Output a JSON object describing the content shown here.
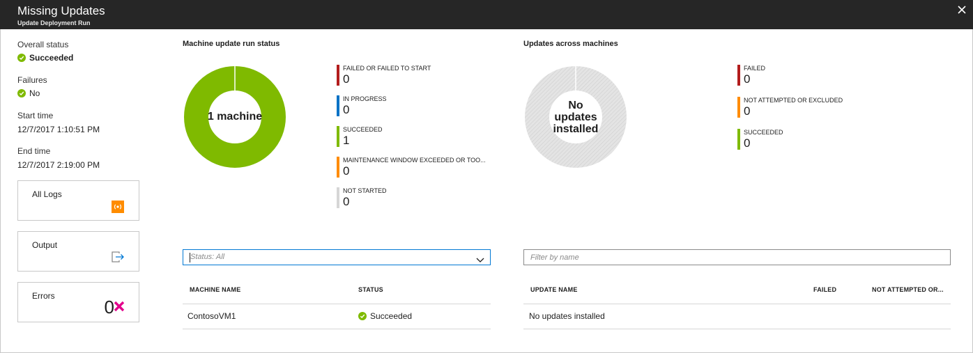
{
  "header": {
    "title": "Missing Updates",
    "subtitle": "Update Deployment Run"
  },
  "summary": {
    "overall_status_label": "Overall status",
    "overall_status_value": "Succeeded",
    "failures_label": "Failures",
    "failures_value": "No",
    "start_time_label": "Start time",
    "start_time_value": "12/7/2017 1:10:51 PM",
    "end_time_label": "End time",
    "end_time_value": "12/7/2017 2:19:00 PM"
  },
  "tiles": {
    "all_logs": "All Logs",
    "output": "Output",
    "errors": "Errors",
    "errors_count": "0"
  },
  "machine_status": {
    "title": "Machine update run status",
    "donut_label": "1 machine",
    "legend": [
      {
        "label": "FAILED OR FAILED TO START",
        "value": "0",
        "color": "#b31d1d"
      },
      {
        "label": "IN PROGRESS",
        "value": "0",
        "color": "#0072c6"
      },
      {
        "label": "SUCCEEDED",
        "value": "1",
        "color": "#7fba00"
      },
      {
        "label": "MAINTENANCE WINDOW EXCEEDED OR TOO...",
        "value": "0",
        "color": "#ff8c00"
      },
      {
        "label": "NOT STARTED",
        "value": "0",
        "color": "#d6d6d6"
      }
    ]
  },
  "updates_across": {
    "title": "Updates across machines",
    "donut_label": "No updates installed",
    "legend": [
      {
        "label": "FAILED",
        "value": "0",
        "color": "#b31d1d"
      },
      {
        "label": "NOT ATTEMPTED OR EXCLUDED",
        "value": "0",
        "color": "#ff8c00"
      },
      {
        "label": "SUCCEEDED",
        "value": "0",
        "color": "#7fba00"
      }
    ]
  },
  "machine_table": {
    "filter_placeholder": "Status: All",
    "columns": [
      "MACHINE NAME",
      "STATUS"
    ],
    "rows": [
      {
        "machine": "ContosoVM1",
        "status": "Succeeded"
      }
    ]
  },
  "updates_table": {
    "filter_placeholder": "Filter by name",
    "columns": [
      "UPDATE NAME",
      "FAILED",
      "NOT ATTEMPTED OR..."
    ],
    "empty_text": "No updates installed"
  },
  "colors": {
    "header_bg": "#262626",
    "success": "#7fba00",
    "error_x": "#e3008c",
    "accent": "#0078d4",
    "log_icon": "#ff8c00"
  }
}
